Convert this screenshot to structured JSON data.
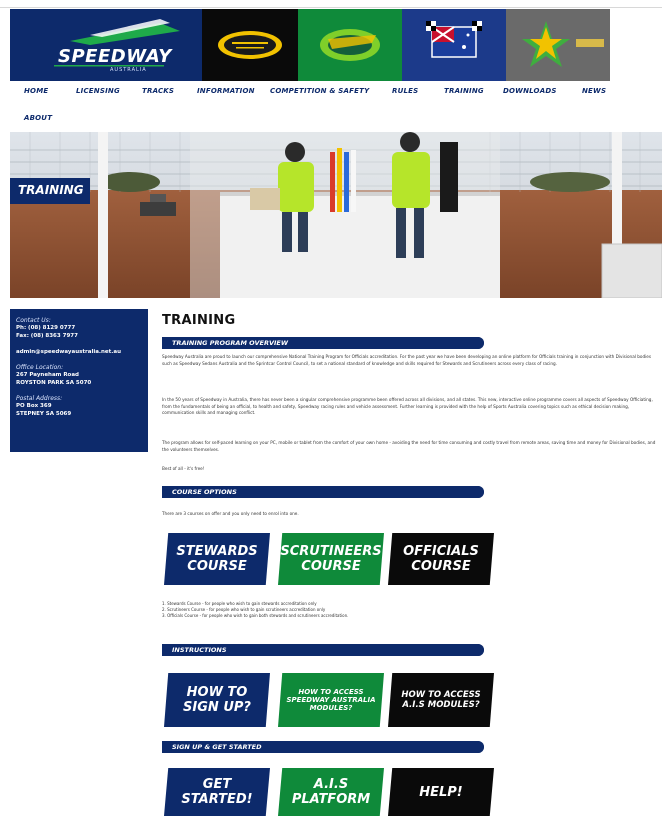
{
  "banner": {
    "logo_text": "SPEEDWAY",
    "logo_sub": "AUSTRALIA"
  },
  "nav": {
    "items": [
      "HOME",
      "LICENSING",
      "TRACKS",
      "INFORMATION",
      "COMPETITION & SAFETY",
      "RULES",
      "TRAINING",
      "DOWNLOADS",
      "NEWS",
      "ABOUT"
    ]
  },
  "hero": {
    "tag": "TRAINING"
  },
  "sidebar": {
    "contact_label": "Contact Us:",
    "phone": "Ph: (08) 8129 0777",
    "fax": "Fax: (08) 8363 7977",
    "email": "admin@speedwayaustralia.net.au",
    "office_label": "Office Location:",
    "office_line1": "267 Payneham Road",
    "office_line2": "ROYSTON PARK SA 5070",
    "postal_label": "Postal Address:",
    "postal_line1": "PO Box 369",
    "postal_line2": "STEPNEY SA 5069"
  },
  "main": {
    "title": "TRAINING",
    "overview_heading": "TRAINING PROGRAM OVERVIEW",
    "para1": "Speedway Australia are proud to launch our comprehensive National Training Program for Officials accreditation. For the past year we have been developing an online platform for Officials training in conjunction with Divisional bodies such as Speedway Sedans Australia and the Sprintcar Control Council, to set a national standard of knowledge and skills required for Stewards and Scrutineers across every class of racing.",
    "para2": "In the 50 years of Speedway in Australia, there has never been a singular comprehensive programme been offered across all divisions, and all states. This new, interactive online programme covers all aspects of Speedway Officiating, from the fundamentals of being an official, to health and safety, Speedway racing rules and vehicle assessment. Further learning is provided with the help of Sports Australia covering topics such as ethical decision making, communication skills and managing conflict.",
    "para3": "The program allows for self-paced learning on your PC, mobile or tablet from the comfort of your own home - avoiding the need for time consuming and costly travel from remote areas, saving time and money for Divisional bodies, and the volunteers themselves.",
    "para4": "Best of all - it's free!",
    "course_heading": "COURSE OPTIONS",
    "course_intro": "There are 3 courses on offer and you only need to enrol into one.",
    "cards1": [
      {
        "line1": "STEWARDS",
        "line2": "COURSE"
      },
      {
        "line1": "SCRUTINEERS",
        "line2": "COURSE"
      },
      {
        "line1": "OFFICIALS",
        "line2": "COURSE"
      }
    ],
    "list": [
      "1. Stewards Course - for people who wish to gain stewards accreditation only",
      "2. Scrutineers Course - for people who wish to gain scrutineers accreditation only",
      "3. Officials Course - for people who wish to gain both stewards and scrutineers accreditation."
    ],
    "instructions_heading": "INSTRUCTIONS",
    "cards2": [
      {
        "line1": "HOW TO",
        "line2": "SIGN UP?",
        "line3": ""
      },
      {
        "line1": "HOW TO ACCESS",
        "line2": "SPEEDWAY AUSTRALIA",
        "line3": "MODULES?"
      },
      {
        "line1": "HOW TO ACCESS",
        "line2": "A.I.S MODULES?",
        "line3": ""
      }
    ],
    "signup_heading": "SIGN UP & GET STARTED",
    "cards3": [
      {
        "line1": "GET",
        "line2": "STARTED!"
      },
      {
        "line1": "A.I.S",
        "line2": "PLATFORM"
      },
      {
        "line1": "HELP!",
        "line2": ""
      }
    ]
  },
  "colors": {
    "navy": "#0d2a6b",
    "green": "#0f8a3a",
    "black": "#0a0a0a"
  }
}
